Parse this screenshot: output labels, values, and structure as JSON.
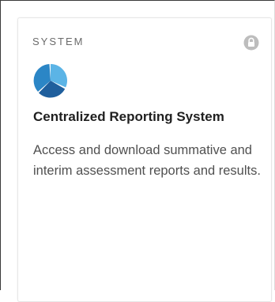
{
  "card": {
    "category": "SYSTEM",
    "title": "Centralized Reporting System",
    "description": "Access and download summative and interim assessment reports and results.",
    "icons": {
      "status": "lock-icon",
      "app": "pie-chart-icon"
    }
  },
  "colors": {
    "icon_dark_blue": "#1f5f9d",
    "icon_mid_blue": "#2b86c6",
    "icon_light_blue": "#5bb4e6",
    "lock_gray": "#bdbdbd",
    "title_text": "#1f1f1f",
    "body_text": "#505050",
    "category_text": "#6b6b6b"
  }
}
